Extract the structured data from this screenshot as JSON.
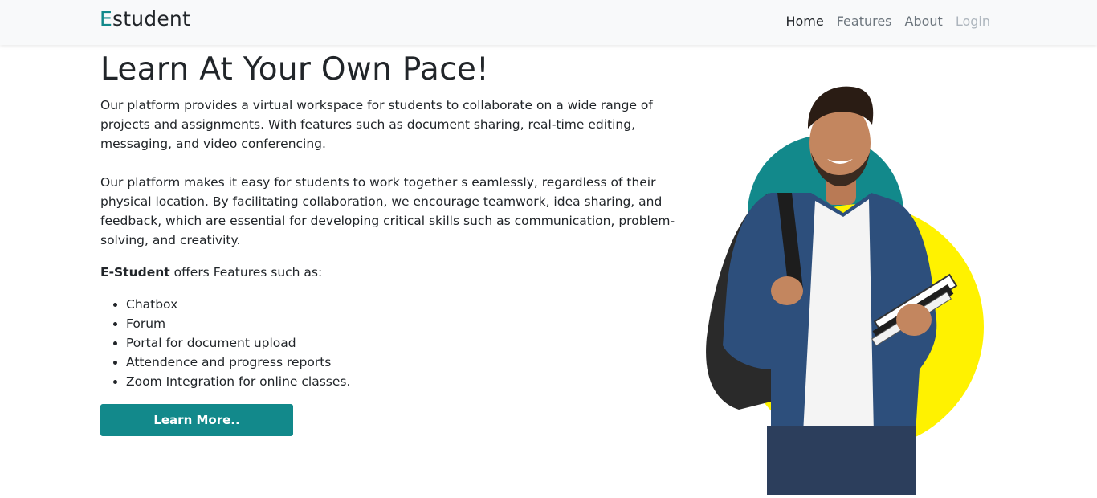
{
  "navbar": {
    "brand_first": "E",
    "brand_rest": "student",
    "links": [
      "Home",
      "Features",
      "About",
      "Login"
    ]
  },
  "main": {
    "title": "Learn At Your Own Pace!",
    "paragraph1": "Our platform provides a virtual workspace for students to collaborate on a wide range of projects and assignments. With features such as document sharing, real-time editing, messaging, and video conferencing.",
    "paragraph2": "Our platform makes it easy for students to work together s eamlessly, regardless of their physical location. By facilitating collaboration, we encourage teamwork, idea sharing, and feedback, which are essential for developing critical skills such as communication, problem-solving, and creativity.",
    "features_intro_bold": "E-Student",
    "features_intro_rest": " offers Features such as:",
    "features": [
      "Chatbox",
      "Forum",
      "Portal for document upload",
      "Attendence and progress reports",
      "Zoom Integration for online classes."
    ],
    "button_label": "Learn More.."
  },
  "colors": {
    "accent": "#12898b",
    "yellow": "#fff200",
    "navbar_bg": "#f8f9fa"
  }
}
